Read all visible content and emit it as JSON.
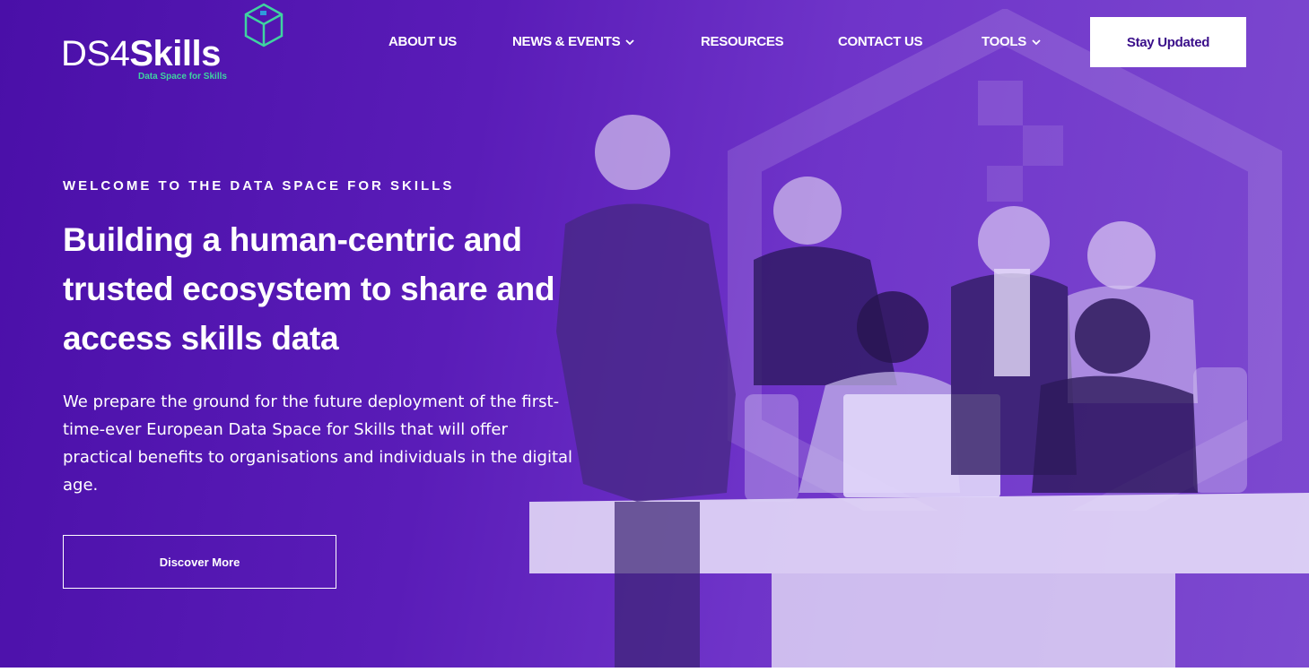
{
  "brand": {
    "logo_ds": "DS4",
    "logo_skills": "Skills",
    "logo_tagline": "Data Space for Skills",
    "logo_icon": "cube-icon"
  },
  "nav": {
    "items": [
      {
        "label": "ABOUT US",
        "has_dropdown": false
      },
      {
        "label": "NEWS & EVENTS",
        "has_dropdown": true
      },
      {
        "label": "RESOURCES",
        "has_dropdown": false
      },
      {
        "label": "CONTACT US",
        "has_dropdown": false
      },
      {
        "label": "TOOLS",
        "has_dropdown": true
      }
    ],
    "cta_label": "Stay Updated"
  },
  "hero": {
    "eyebrow": "WELCOME TO THE DATA SPACE FOR SKILLS",
    "headline_lines": [
      "Building a human-centric and",
      "trusted ecosystem to share and",
      "access skills data"
    ],
    "description_lines": [
      "We prepare the ground for the future deployment of the first-",
      "time-ever European Data Space for Skills that will offer",
      "practical benefits to organisations and individuals in the digital",
      "age."
    ],
    "button_label": "Discover More"
  },
  "colors": {
    "primary": "#5a1cb8",
    "accent": "#3fd3a0",
    "cta_text": "#3a0f8a"
  }
}
